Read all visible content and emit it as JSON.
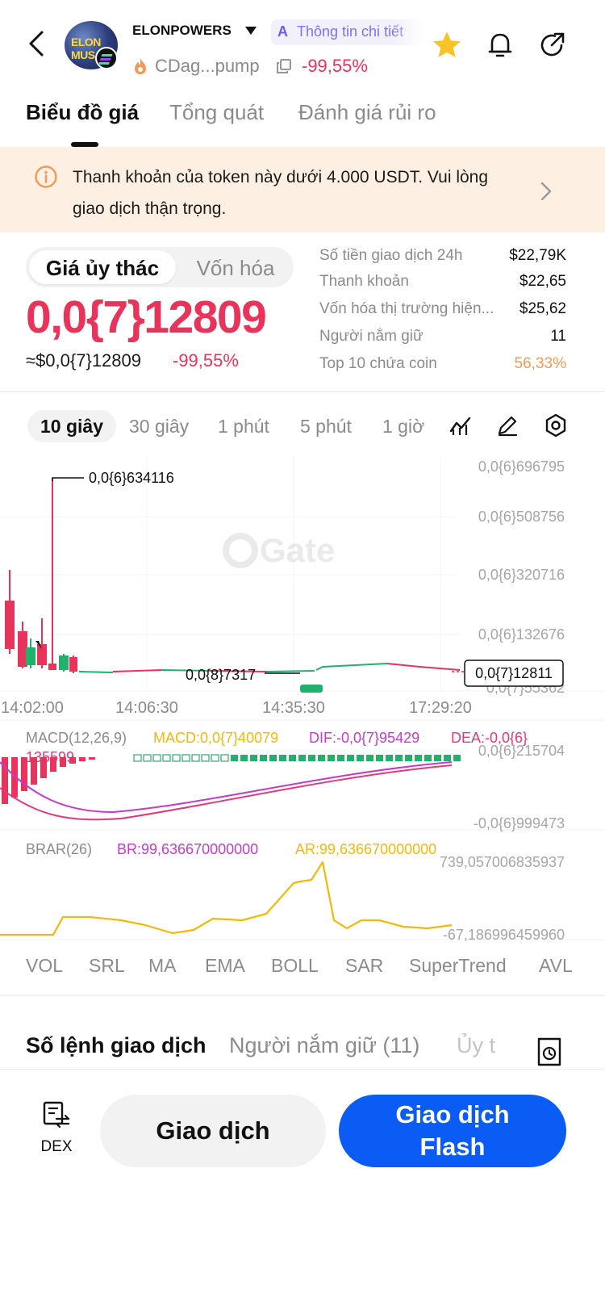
{
  "header": {
    "token_name": "ELONPOWERS",
    "avatar_text": "ELON MUS",
    "ai_label": "Thông tin chi tiết",
    "address": "CDag...pump",
    "change": "-99,55%"
  },
  "tabs": [
    {
      "label": "Biểu đồ giá",
      "active": true
    },
    {
      "label": "Tổng quát",
      "active": false
    },
    {
      "label": "Đánh giá rủi ro",
      "active": false
    }
  ],
  "warning": {
    "text": "Thanh khoản của token này dưới 4.000 USDT. Vui lòng giao dịch thận trọng."
  },
  "price": {
    "toggle_active": "Giá ủy thác",
    "toggle_inactive": "Vốn hóa",
    "main": "0,0{7}12809",
    "usd": "≈$0,0{7}12809",
    "change": "-99,55%"
  },
  "stats": [
    {
      "label": "Số tiền giao dịch 24h",
      "value": "$22,79K"
    },
    {
      "label": "Thanh khoản",
      "value": "$22,65"
    },
    {
      "label": "Vốn hóa thị trường hiện...",
      "value": "$25,62"
    },
    {
      "label": "Người nắm giữ",
      "value": "11"
    },
    {
      "label": "Top 10 chứa coin",
      "value": "56,33%",
      "color": "#f29a55"
    }
  ],
  "intervals": [
    "10 giây",
    "30 giây",
    "1 phút",
    "5 phút",
    "1 giờ"
  ],
  "active_interval": "10 giây",
  "chart": {
    "watermark": "Gate",
    "price_axis": [
      "0,0{6}696795",
      "0,0{6}508756",
      "0,0{6}320716",
      "0,0{6}132676",
      "0,0{7}55362"
    ],
    "high_label": "0,0{6}634116",
    "low_label": "0,0{8}7317",
    "current_price_label": "0,0{7}12811",
    "time_axis": [
      "14:02:00",
      "14:06:30",
      "14:35:30",
      "17:29:20"
    ],
    "macd": {
      "name": "MACD(12,26,9)",
      "macd": "MACD:0,0{7}40079",
      "dif": "DIF:-0,0{7}95429",
      "dea": "DEA:-0,0{6}",
      "dea_cont": "135599",
      "axis_top": "0,0{6}215704",
      "axis_bottom": "-0,0{6}999473"
    },
    "brar": {
      "name": "BRAR(26)",
      "br": "BR:99,636670000000",
      "ar": "AR:99,636670000000",
      "axis_top": "739,057006835937",
      "axis_bottom": "-67,186996459960"
    }
  },
  "indicators": [
    "VOL",
    "SRL",
    "MA",
    "EMA",
    "BOLL",
    "SAR",
    "SuperTrend",
    "AVL"
  ],
  "bottom_tabs": [
    {
      "label": "Số lệnh giao dịch",
      "state": "active"
    },
    {
      "label": "Người nắm giữ (11)",
      "state": "normal"
    },
    {
      "label": "Ủy t",
      "state": "fade"
    }
  ],
  "actions": {
    "dex_label": "DEX",
    "trade_label": "Giao dịch",
    "flash_label_1": "Giao dịch",
    "flash_label_2": "Flash"
  },
  "colors": {
    "down": "#e8335a",
    "up": "#20b26c",
    "accent_blue": "#0a5cf5",
    "warning_bg": "#fdf0e3",
    "star": "#f7c325",
    "ar_line": "#f0b90b",
    "dif_line": "#c33cc9",
    "dea_line": "#e03a7a"
  }
}
